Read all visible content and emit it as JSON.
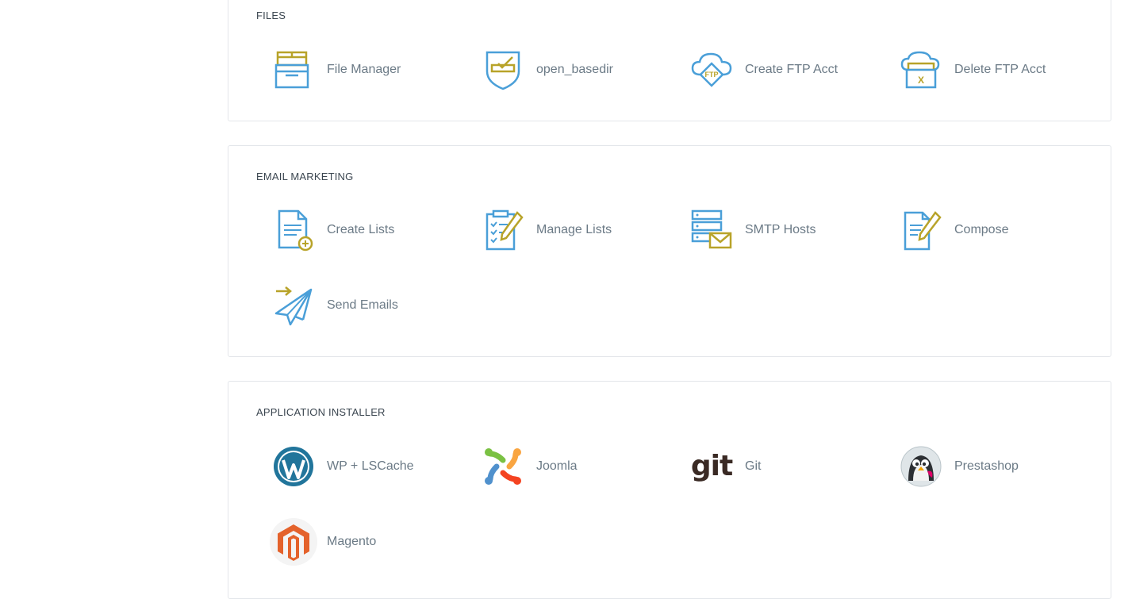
{
  "sections": {
    "files": {
      "title": "FILES",
      "items": [
        {
          "label": "File Manager",
          "icon": "file-manager-icon"
        },
        {
          "label": "open_basedir",
          "icon": "shield-check-icon"
        },
        {
          "label": "Create FTP Acct",
          "icon": "ftp-cloud-icon",
          "badge": "FTP"
        },
        {
          "label": "Delete FTP Acct",
          "icon": "ftp-delete-icon",
          "badge": "X"
        }
      ]
    },
    "email_marketing": {
      "title": "EMAIL MARKETING",
      "items": [
        {
          "label": "Create Lists",
          "icon": "document-plus-icon"
        },
        {
          "label": "Manage Lists",
          "icon": "clipboard-checklist-icon"
        },
        {
          "label": "SMTP Hosts",
          "icon": "server-mail-icon"
        },
        {
          "label": "Compose",
          "icon": "document-pencil-icon"
        },
        {
          "label": "Send Emails",
          "icon": "paper-plane-icon"
        }
      ]
    },
    "application_installer": {
      "title": "APPLICATION INSTALLER",
      "items": [
        {
          "label": "WP + LSCache",
          "icon": "wordpress-icon"
        },
        {
          "label": "Joomla",
          "icon": "joomla-icon"
        },
        {
          "label": "Git",
          "icon": "git-icon",
          "logo_text": "git"
        },
        {
          "label": "Prestashop",
          "icon": "prestashop-icon"
        },
        {
          "label": "Magento",
          "icon": "magento-icon"
        }
      ]
    }
  },
  "colors": {
    "icon_blue": "#4a9fd8",
    "icon_gold": "#b8a329",
    "text": "#6b7a86",
    "title": "#3b4650",
    "border": "#e3e6ea",
    "wordpress": "#21759b",
    "magento": "#e4622b"
  }
}
